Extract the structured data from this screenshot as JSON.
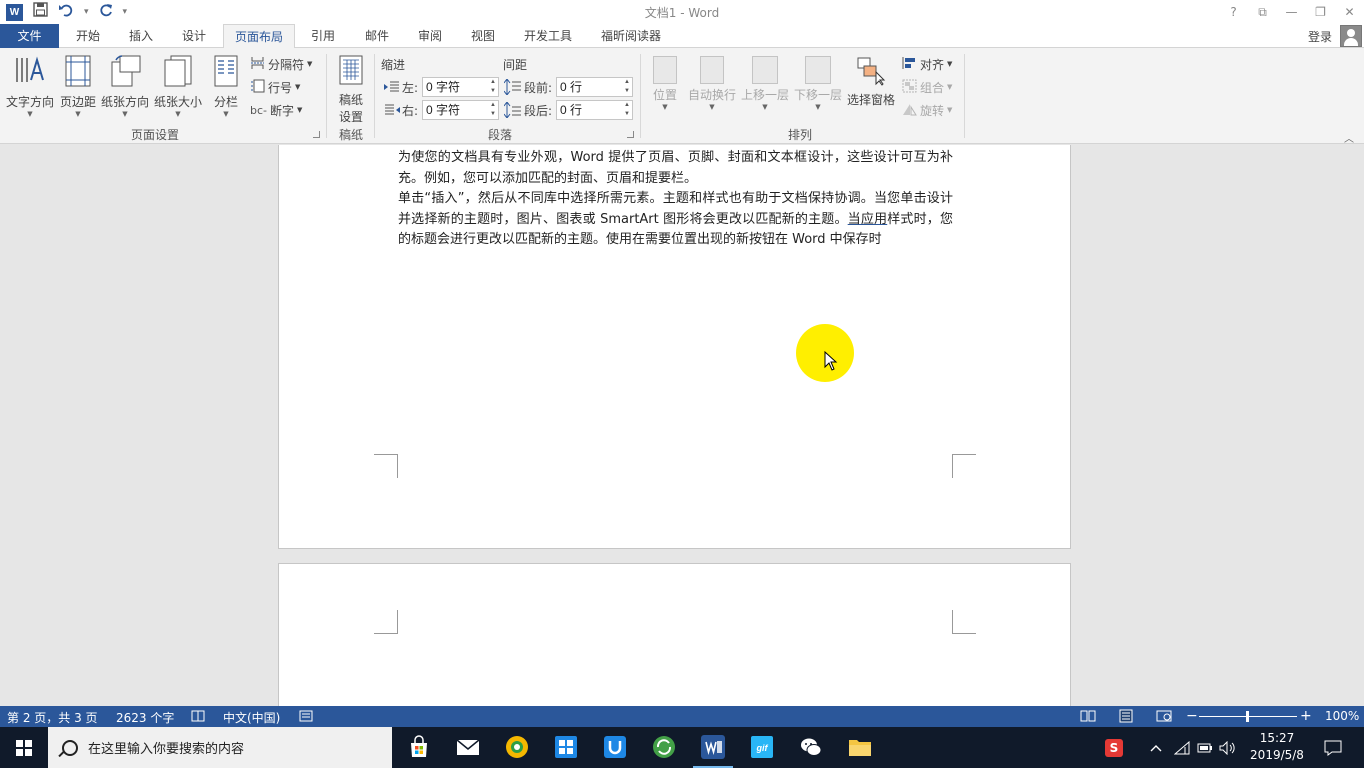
{
  "app": {
    "title": "文档1 - Word",
    "word_letter": "W"
  },
  "window_controls": [
    "?",
    "⧉",
    "—",
    "❐",
    "✕"
  ],
  "tabs": [
    {
      "label": "文件"
    },
    {
      "label": "开始"
    },
    {
      "label": "插入"
    },
    {
      "label": "设计"
    },
    {
      "label": "页面布局"
    },
    {
      "label": "引用"
    },
    {
      "label": "邮件"
    },
    {
      "label": "审阅"
    },
    {
      "label": "视图"
    },
    {
      "label": "开发工具"
    },
    {
      "label": "福昕阅读器"
    }
  ],
  "login_label": "登录",
  "ribbon": {
    "page_setup": {
      "label": "页面设置",
      "text_direction": "文字方向",
      "margins": "页边距",
      "orientation": "纸张方向",
      "size": "纸张大小",
      "columns": "分栏",
      "breaks": "分隔符",
      "line_numbers": "行号",
      "hyphenation": "断字"
    },
    "draft": {
      "label": "稿纸",
      "button_line1": "稿纸",
      "button_line2": "设置"
    },
    "paragraph": {
      "label": "段落",
      "indent_title": "缩进",
      "spacing_title": "间距",
      "left_label": "左:",
      "right_label": "右:",
      "before_label": "段前:",
      "after_label": "段后:",
      "left_value": "0 字符",
      "right_value": "0 字符",
      "before_value": "0 行",
      "after_value": "0 行"
    },
    "arrange": {
      "label": "排列",
      "position": "位置",
      "wrap_text": "自动换行",
      "bring_forward": "上移一层",
      "send_backward": "下移一层",
      "selection_pane": "选择窗格",
      "align": "对齐",
      "group": "组合",
      "rotate": "旋转"
    }
  },
  "document": {
    "paragraph1": "为使您的文档具有专业外观，Word 提供了页眉、页脚、封面和文本框设计，这些设计可互为补充。例如，您可以添加匹配的封面、页眉和提要栏。",
    "paragraph2_a": "单击“插入”，然后从不同库中选择所需元素。主题和样式也有助于文档保持协调。当您单击设计并选择新的主题时，图片、图表或 SmartArt 图形将会更改以匹配新的主题。",
    "paragraph2_underlined": "当应用",
    "paragraph2_b": "样式时，您的标题会进行更改以匹配新的主题。使用在需要位置出现的新按钮在 Word 中保存时"
  },
  "status": {
    "page": "第 2 页，共 3 页",
    "words": "2623 个字",
    "language": "中文(中国)",
    "zoom_minus": "−",
    "zoom_plus": "+",
    "zoom": "100%",
    "zoom_level_percent": 100
  },
  "taskbar": {
    "search_placeholder": "在这里输入你要搜索的内容",
    "time": "15:27",
    "date": "2019/5/8",
    "ime_badge": "S"
  },
  "colors": {
    "word_blue": "#2b579a",
    "highlight_yellow": "#ffef00",
    "taskbar_bg": "#101a2a"
  }
}
